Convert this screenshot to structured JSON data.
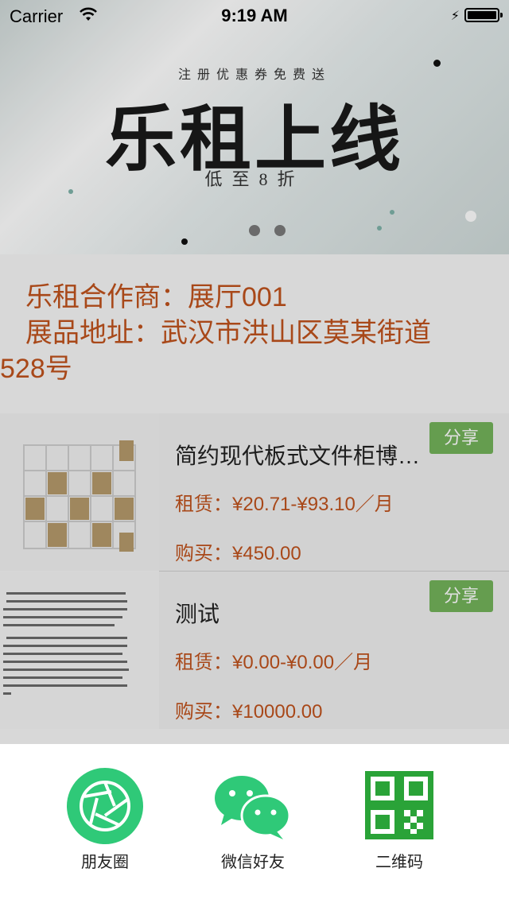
{
  "status_bar": {
    "carrier": "Carrier",
    "time": "9:19 AM"
  },
  "banner": {
    "subtitle": "注册优惠券免费送",
    "headline": "乐租上线",
    "discount": "低至8折",
    "page_count": 2
  },
  "info": {
    "partner": "乐租合作商：展厅001",
    "address_line1": "展品地址：武汉市洪山区莫某街道",
    "address_line2": "528号"
  },
  "products": [
    {
      "name": "简约现代板式文件柜博…",
      "rent": "租赁：¥20.71-¥93.10／月",
      "buy": "购买：¥450.00",
      "share": "分享",
      "thumb_icon": "bookshelf-image"
    },
    {
      "name": "测试",
      "rent": "租赁：¥0.00-¥0.00／月",
      "buy": "购买：¥10000.00",
      "share": "分享",
      "thumb_icon": "document-image"
    }
  ],
  "share_sheet": {
    "options": [
      {
        "label": "朋友圈",
        "icon": "moments-icon"
      },
      {
        "label": "微信好友",
        "icon": "wechat-icon"
      },
      {
        "label": "二维码",
        "icon": "qr-code-icon"
      }
    ]
  },
  "colors": {
    "accent": "#c0531d",
    "share_green": "#74b35a",
    "wechat_green": "#2fc978",
    "qr_green": "#2aa338"
  }
}
